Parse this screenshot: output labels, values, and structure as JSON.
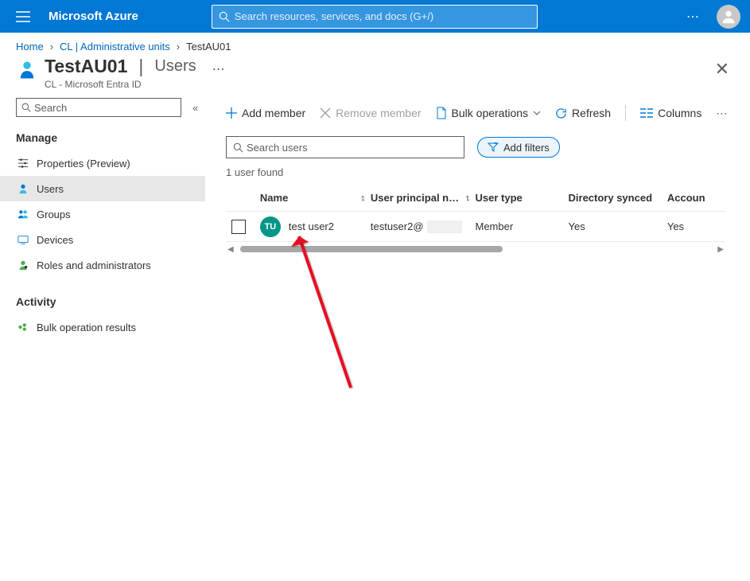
{
  "header": {
    "brand": "Microsoft Azure",
    "search_placeholder": "Search resources, services, and docs (G+/)"
  },
  "breadcrumb": {
    "home": "Home",
    "level1": "CL | Administrative units",
    "current": "TestAU01"
  },
  "page": {
    "title": "TestAU01",
    "section": "Users",
    "subtitle": "CL - Microsoft Entra ID"
  },
  "sidebar": {
    "search_placeholder": "Search",
    "manage_heading": "Manage",
    "manage_items": [
      {
        "label": "Properties (Preview)"
      },
      {
        "label": "Users"
      },
      {
        "label": "Groups"
      },
      {
        "label": "Devices"
      },
      {
        "label": "Roles and administrators"
      }
    ],
    "activity_heading": "Activity",
    "activity_items": [
      {
        "label": "Bulk operation results"
      }
    ]
  },
  "toolbar": {
    "add_member": "Add member",
    "remove_member": "Remove member",
    "bulk_ops": "Bulk operations",
    "refresh": "Refresh",
    "columns": "Columns"
  },
  "filters": {
    "search_placeholder": "Search users",
    "add_filters": "Add filters"
  },
  "results": {
    "count_text": "1 user found"
  },
  "table": {
    "col_name": "Name",
    "col_upn": "User principal n…",
    "col_type": "User type",
    "col_dir": "Directory synced",
    "col_acc": "Accoun",
    "rows": [
      {
        "initials": "TU",
        "name": "test user2",
        "upn_prefix": "testuser2@",
        "user_type": "Member",
        "dir_synced": "Yes",
        "account": "Yes"
      }
    ]
  }
}
